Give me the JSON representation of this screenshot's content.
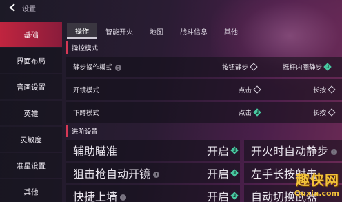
{
  "header": {
    "title": "设置"
  },
  "sidebar": {
    "items": [
      {
        "label": "基础",
        "active": true
      },
      {
        "label": "界面布局",
        "active": false
      },
      {
        "label": "音画设置",
        "active": false
      },
      {
        "label": "英雄",
        "active": false
      },
      {
        "label": "灵敏度",
        "active": false
      },
      {
        "label": "准星设置",
        "active": false
      },
      {
        "label": "其他",
        "active": false
      }
    ]
  },
  "tabs": [
    {
      "label": "操作",
      "active": true
    },
    {
      "label": "智能开火",
      "active": false
    },
    {
      "label": "地图",
      "active": false
    },
    {
      "label": "战斗信息",
      "active": false
    },
    {
      "label": "其他",
      "active": false
    }
  ],
  "sections": {
    "control": {
      "title": "操控模式"
    },
    "advanced": {
      "title": "进阶设置"
    }
  },
  "rows": {
    "walk_mode": {
      "label": "静步操作模式",
      "opt1": "按钮静步",
      "opt1_on": false,
      "opt2": "摇杆内圈静步",
      "opt2_on": true
    },
    "open_mirror": {
      "label": "开镜模式",
      "opt1": "点击",
      "opt1_on": false,
      "opt2": "长按",
      "opt2_on": false
    },
    "crouch": {
      "label": "下蹲模式",
      "opt1": "点击",
      "opt1_on": true,
      "opt2": "长按",
      "opt2_on": false
    },
    "aim_assist": {
      "label": "辅助瞄准",
      "value": "开启",
      "on": true
    },
    "fire_walk": {
      "label": "开火时自动静步"
    },
    "sniper_auto": {
      "label": "狙击枪自动开镜",
      "value": "开启",
      "on": true
    },
    "left_hand": {
      "label": "左手长按射击"
    },
    "quick_climb": {
      "label": "快捷上墙",
      "value": "开启",
      "on": true
    },
    "auto_weapon": {
      "label": "自动切换武器"
    }
  },
  "watermark": {
    "main": "趣侠网",
    "sub": "Quxia.com"
  },
  "colors": {
    "accent": "#c0253f",
    "check": "#49c7a0",
    "watermark": "#f2c23a"
  }
}
